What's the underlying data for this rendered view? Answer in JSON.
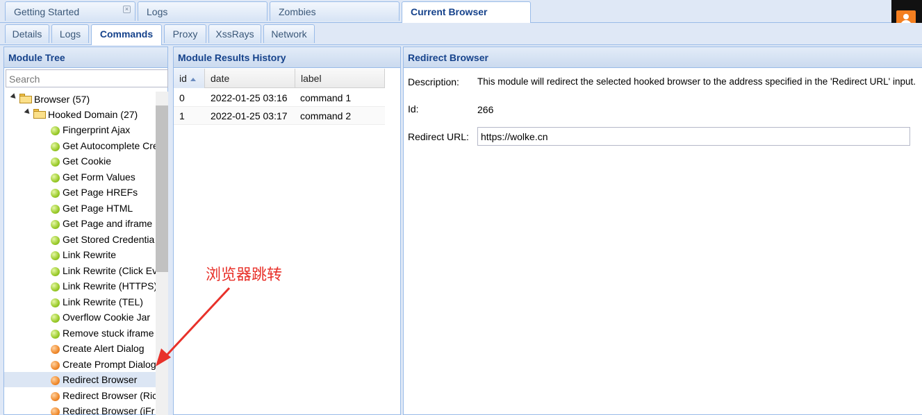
{
  "top_tabs": [
    "Getting Started",
    "Logs",
    "Zombies",
    "Current Browser"
  ],
  "sub_tabs": [
    "Details",
    "Logs",
    "Commands",
    "Proxy",
    "XssRays",
    "Network"
  ],
  "module_tree": {
    "title": "Module Tree",
    "search_placeholder": "Search",
    "root": "Browser (57)",
    "domain": "Hooked Domain (27)",
    "items": [
      {
        "label": "Fingerprint Ajax",
        "status": "green"
      },
      {
        "label": "Get Autocomplete Cre",
        "status": "green"
      },
      {
        "label": "Get Cookie",
        "status": "green"
      },
      {
        "label": "Get Form Values",
        "status": "green"
      },
      {
        "label": "Get Page HREFs",
        "status": "green"
      },
      {
        "label": "Get Page HTML",
        "status": "green"
      },
      {
        "label": "Get Page and iframe",
        "status": "green"
      },
      {
        "label": "Get Stored Credentia",
        "status": "green"
      },
      {
        "label": "Link Rewrite",
        "status": "green"
      },
      {
        "label": "Link Rewrite (Click Ev",
        "status": "green"
      },
      {
        "label": "Link Rewrite (HTTPS)",
        "status": "green"
      },
      {
        "label": "Link Rewrite (TEL)",
        "status": "green"
      },
      {
        "label": "Overflow Cookie Jar",
        "status": "green"
      },
      {
        "label": "Remove stuck iframe",
        "status": "green"
      },
      {
        "label": "Create Alert Dialog",
        "status": "orange"
      },
      {
        "label": "Create Prompt Dialog",
        "status": "orange"
      },
      {
        "label": "Redirect Browser",
        "status": "orange",
        "selected": true
      },
      {
        "label": "Redirect Browser (Ric",
        "status": "orange"
      },
      {
        "label": "Redirect Browser (iFr",
        "status": "orange"
      }
    ]
  },
  "results_history": {
    "title": "Module Results History",
    "columns": [
      "id",
      "date",
      "label"
    ],
    "rows": [
      [
        "0",
        "2022-01-25 03:16",
        "command 1"
      ],
      [
        "1",
        "2022-01-25 03:17",
        "command 2"
      ]
    ]
  },
  "redirect": {
    "title": "Redirect Browser",
    "description_label": "Description:",
    "description": "This module will redirect the selected hooked browser to the address specified in the 'Redirect URL' input.",
    "id_label": "Id:",
    "id_value": "266",
    "url_label": "Redirect URL:",
    "url_value": "https://wolke.cn"
  },
  "annotation": "浏览器跳转",
  "colors": {
    "accent": "#15428b",
    "annotation": "#e8312a",
    "selected_row": "#dce6f4"
  }
}
